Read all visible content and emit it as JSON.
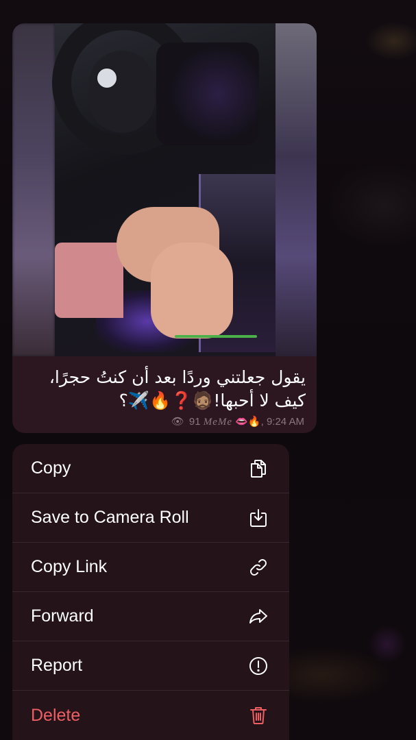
{
  "message": {
    "caption_line1": "يقول جعلتني وردًا بعد أن كنتُ حجرًا،",
    "caption_line2": "كيف لا أحبها!🧔🏽❓🔥✈️؟",
    "views": "91",
    "signature": "MeMe",
    "signature_emojis": "👄🔥",
    "time": "9:24 AM"
  },
  "menu": {
    "items": [
      {
        "label": "Copy",
        "icon": "copy-icon"
      },
      {
        "label": "Save to Camera Roll",
        "icon": "save-icon"
      },
      {
        "label": "Copy Link",
        "icon": "link-icon"
      },
      {
        "label": "Forward",
        "icon": "forward-icon"
      },
      {
        "label": "Report",
        "icon": "report-icon"
      },
      {
        "label": "Delete",
        "icon": "trash-icon"
      }
    ]
  },
  "colors": {
    "bubble": "#2c1620",
    "menu_bg": "#241319",
    "danger": "#ee5f63",
    "meta": "#8c7680"
  }
}
